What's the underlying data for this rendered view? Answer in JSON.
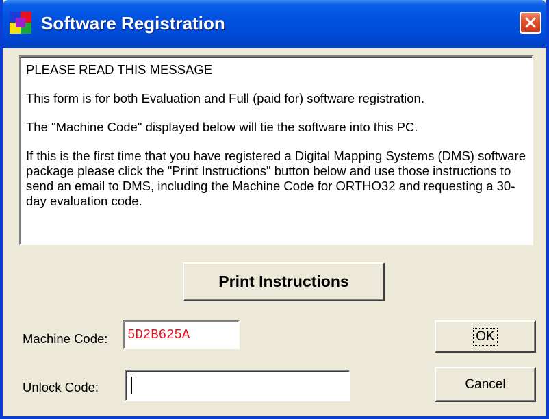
{
  "window": {
    "title": "Software Registration",
    "icon": "app-logo-icon",
    "close_icon": "close-icon"
  },
  "message": {
    "heading": "PLEASE READ THIS MESSAGE",
    "paragraphs": [
      "This form is for both Evaluation and Full (paid for) software registration.",
      "The \"Machine Code\" displayed below will tie the software into this PC.",
      "If this is the first time that you have registered a Digital Mapping Systems (DMS) software package please click the \"Print Instructions\" button below and use those instructions to send an email to DMS, including the Machine Code for ORTHO32 and requesting a 30-day evaluation code."
    ]
  },
  "buttons": {
    "print_instructions": "Print Instructions",
    "ok": "OK",
    "cancel": "Cancel"
  },
  "fields": {
    "machine_code_label": "Machine Code:",
    "machine_code_value": "5D2B625A",
    "unlock_code_label": "Unlock Code:",
    "unlock_code_value": ""
  },
  "colors": {
    "titlebar": "#0052e0",
    "window_face": "#ece9d8",
    "machine_code_text": "#e8101c",
    "close_button": "#e3512a"
  }
}
